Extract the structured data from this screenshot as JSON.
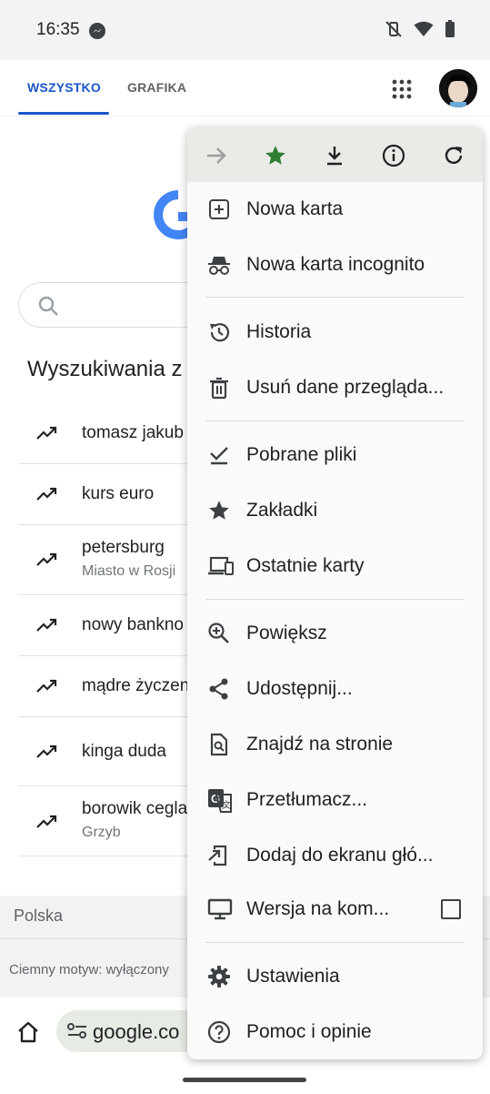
{
  "status_bar": {
    "time": "16:35"
  },
  "google_header": {
    "tabs": [
      {
        "label": "WSZYSTKO",
        "active": true
      },
      {
        "label": "GRAFIKA",
        "active": false
      }
    ]
  },
  "trending": {
    "title": "Wyszukiwania z",
    "items": [
      {
        "label": "tomasz jakub",
        "sub": ""
      },
      {
        "label": "kurs euro",
        "sub": ""
      },
      {
        "label": "petersburg",
        "sub": "Miasto w Rosji"
      },
      {
        "label": "nowy bankno",
        "sub": ""
      },
      {
        "label": "mądre życzen",
        "sub": ""
      },
      {
        "label": "kinga duda",
        "sub": ""
      },
      {
        "label": "borowik cegla",
        "sub": "Grzyb"
      }
    ]
  },
  "footer": {
    "country": "Polska",
    "dark_mode": "Ciemny motyw: wyłączony"
  },
  "omnibox": {
    "url": "google.co"
  },
  "menu": {
    "toolbar_icons": [
      "forward-arrow-icon",
      "bookmark-star-icon",
      "download-icon",
      "info-icon",
      "reload-icon"
    ],
    "items": [
      {
        "label": "Nowa karta",
        "icon": "new-tab-icon"
      },
      {
        "label": "Nowa karta incognito",
        "icon": "incognito-icon"
      },
      {
        "label": "Historia",
        "icon": "history-icon"
      },
      {
        "label": "Usuń dane przegląda...",
        "icon": "trash-icon"
      },
      {
        "label": "Pobrane pliki",
        "icon": "downloads-check-icon"
      },
      {
        "label": "Zakładki",
        "icon": "bookmarks-star-icon"
      },
      {
        "label": "Ostatnie karty",
        "icon": "devices-icon"
      },
      {
        "label": "Powiększ",
        "icon": "zoom-icon"
      },
      {
        "label": "Udostępnij...",
        "icon": "share-icon"
      },
      {
        "label": "Znajdź na stronie",
        "icon": "find-in-page-icon"
      },
      {
        "label": "Przetłumacz...",
        "icon": "translate-icon"
      },
      {
        "label": "Dodaj do ekranu głó...",
        "icon": "add-to-home-icon"
      },
      {
        "label": "Wersja na kom...",
        "icon": "desktop-icon",
        "checked": false
      },
      {
        "label": "Ustawienia",
        "icon": "settings-gear-icon"
      },
      {
        "label": "Pomoc i opinie",
        "icon": "help-icon"
      }
    ]
  },
  "colors": {
    "accent_blue": "#1a56c9",
    "bookmark_green": "#2e7d32",
    "menu_toolbar_bg": "#e8ebe6"
  }
}
